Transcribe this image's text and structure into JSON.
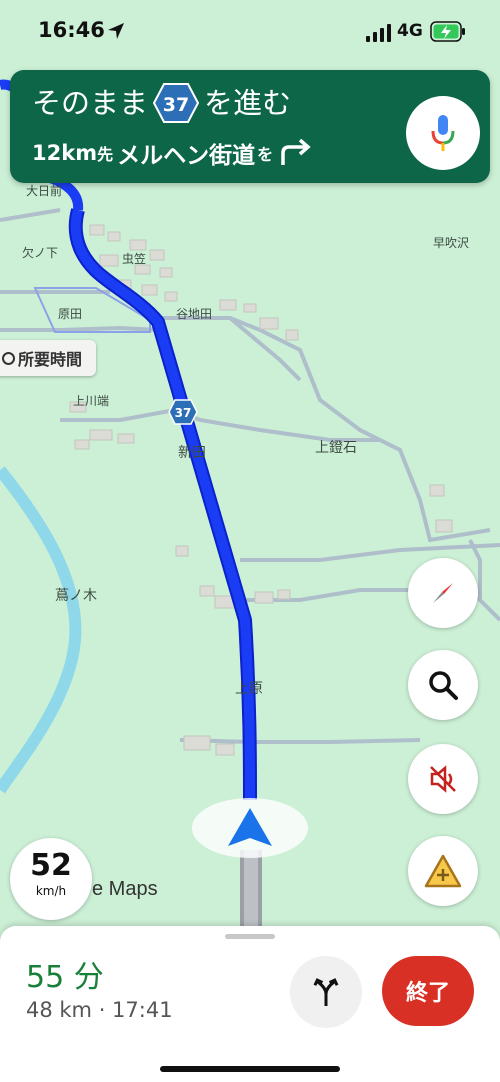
{
  "status_bar": {
    "time": "16:46",
    "network": "4G",
    "battery_color": "#34c759"
  },
  "direction": {
    "line1_prefix": "そのまま",
    "route_number": "37",
    "line1_suffix": "を進む",
    "distance": "12km",
    "distance_suffix": "先",
    "road_name": "メルヘン街道",
    "road_particle": "を",
    "turn_icon": "turn-right-icon",
    "mic_icon": "mic-icon",
    "banner_color": "#0c6647"
  },
  "map": {
    "labels": {
      "oohinomae": "大日前",
      "kakunoshita": "欠ノ下",
      "mushikasa": "虫笠",
      "harada": "原田",
      "yachida": "谷地田",
      "hayafukizawa": "早吹沢",
      "kamikawabata": "上川端",
      "shinden": "新田",
      "kamiabumiishi": "上鐙石",
      "tsutanoki": "蔦ノ木",
      "uehara": "上原"
    },
    "route_marker": "37",
    "duration_chip": "所要時間",
    "route_color": "#1a3cf5",
    "attribution": "e Maps"
  },
  "buttons": {
    "compass_icon": "compass-icon",
    "search_icon": "search-icon",
    "mute_icon": "volume-off-icon",
    "report_icon": "add-report-icon"
  },
  "speed": {
    "value": "52",
    "unit": "km/h"
  },
  "panel": {
    "duration": "55 分",
    "details": "48 km · 17:41",
    "alt_routes_icon": "alternate-routes-icon",
    "end_label": "終了",
    "end_color": "#d93025",
    "duration_color": "#188038"
  }
}
